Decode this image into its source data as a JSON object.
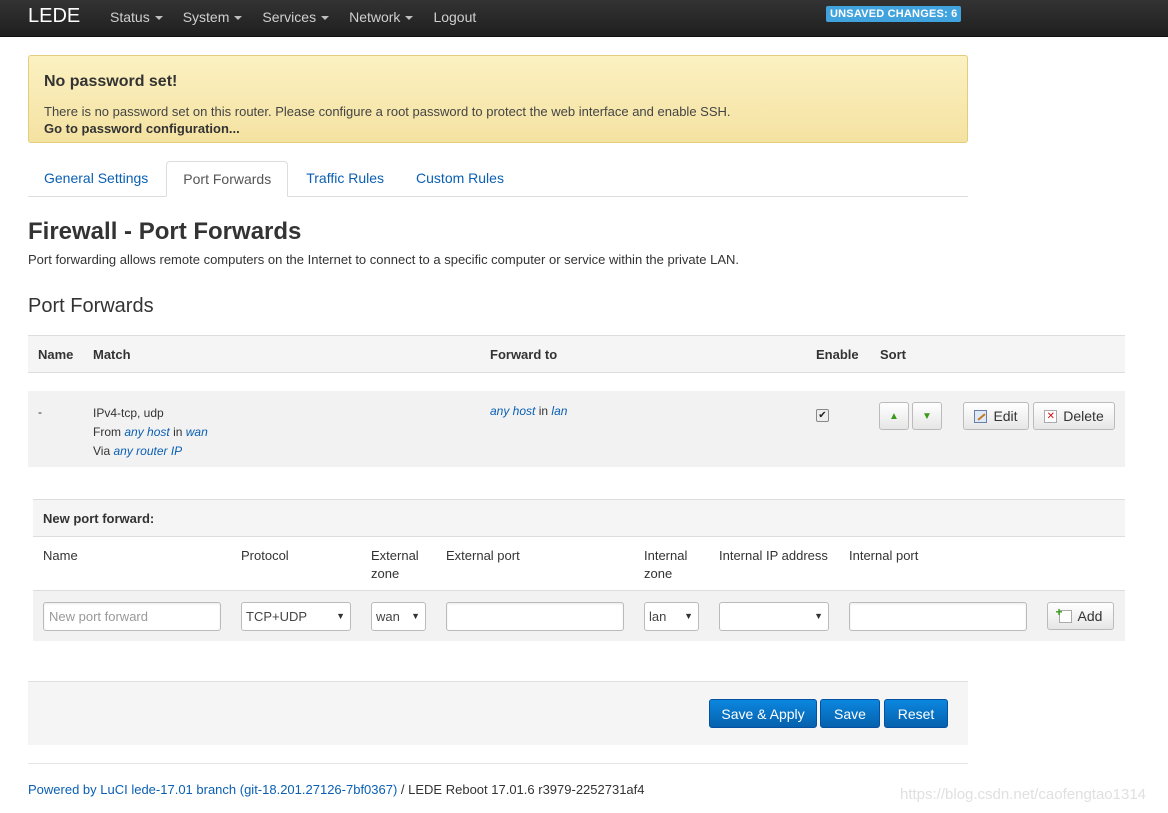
{
  "header": {
    "brand": "LEDE",
    "nav": [
      {
        "label": "Status",
        "dropdown": true
      },
      {
        "label": "System",
        "dropdown": true
      },
      {
        "label": "Services",
        "dropdown": true
      },
      {
        "label": "Network",
        "dropdown": true
      },
      {
        "label": "Logout",
        "dropdown": false
      }
    ],
    "unsaved": "UNSAVED CHANGES: 6"
  },
  "alert": {
    "title": "No password set!",
    "text": "There is no password set on this router. Please configure a root password to protect the web interface and enable SSH.",
    "link": "Go to password configuration..."
  },
  "tabs": [
    {
      "label": "General Settings",
      "active": false
    },
    {
      "label": "Port Forwards",
      "active": true
    },
    {
      "label": "Traffic Rules",
      "active": false
    },
    {
      "label": "Custom Rules",
      "active": false
    }
  ],
  "page": {
    "title": "Firewall - Port Forwards",
    "description": "Port forwarding allows remote computers on the Internet to connect to a specific computer or service within the private LAN."
  },
  "section": {
    "title": "Port Forwards",
    "columns": {
      "name": "Name",
      "match": "Match",
      "forward_to": "Forward to",
      "enable": "Enable",
      "sort": "Sort"
    },
    "rule": {
      "name": "-",
      "match_line1": "IPv4-tcp, udp",
      "from_prefix": "From",
      "from_host": "any host",
      "in_word": "in",
      "from_zone": "wan",
      "via_prefix": "Via",
      "via_target": "any router IP",
      "fwd_host": "any host",
      "fwd_in": "in",
      "fwd_zone": "lan",
      "enabled": "✔",
      "up_icon": "arrow-up-icon",
      "down_icon": "arrow-down-icon",
      "edit_label": "Edit",
      "delete_label": "Delete"
    }
  },
  "new_forward": {
    "title": "New port forward:",
    "labels": {
      "name": "Name",
      "protocol": "Protocol",
      "external_zone": "External zone",
      "external_port": "External port",
      "internal_zone": "Internal zone",
      "internal_ip": "Internal IP address",
      "internal_port": "Internal port"
    },
    "name_placeholder": "New port forward",
    "protocol_value": "TCP+UDP",
    "external_zone_value": "wan",
    "external_port_value": "",
    "internal_zone_value": "lan",
    "internal_ip_value": "",
    "internal_port_value": "",
    "add_label": "Add"
  },
  "actions": {
    "save_apply": "Save & Apply",
    "save": "Save",
    "reset": "Reset"
  },
  "footer": {
    "powered_by": "Powered by LuCI lede-17.01 branch (git-18.201.27126-7bf0367)",
    "version": " / LEDE Reboot 17.01.6 r3979-2252731af4"
  },
  "watermark": "https://blog.csdn.net/caofengtao1314",
  "colors": {
    "primary": "#0a7ad0",
    "link": "#0a5fb3",
    "badge": "#41a3de",
    "alert_bg": "#f7e8ae"
  }
}
